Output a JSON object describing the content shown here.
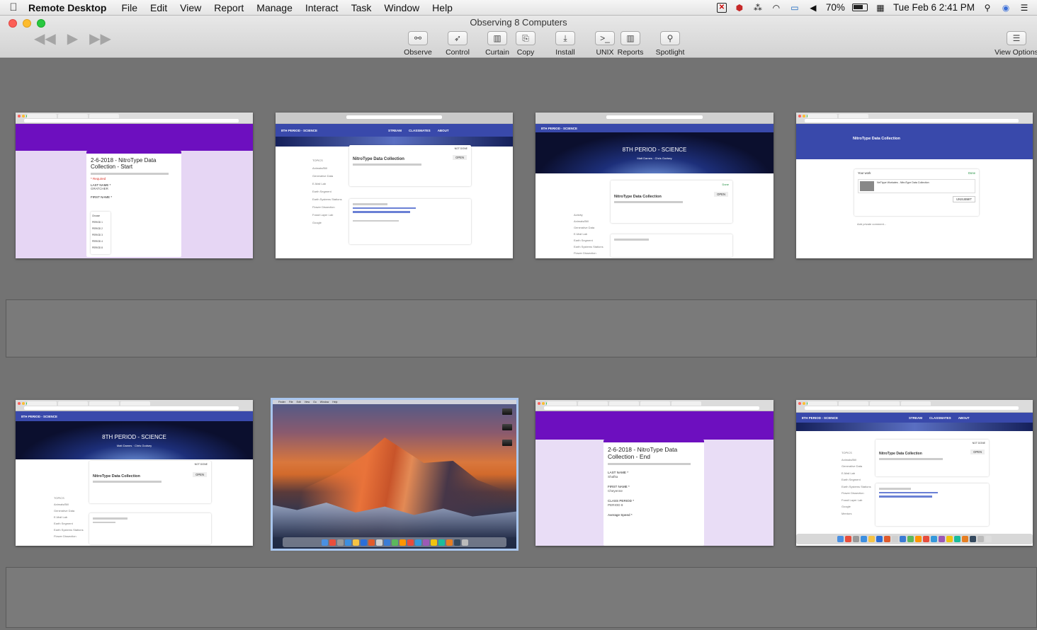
{
  "menubar": {
    "app_name": "Remote Desktop",
    "menus": [
      "File",
      "Edit",
      "View",
      "Report",
      "Manage",
      "Interact",
      "Task",
      "Window",
      "Help"
    ],
    "battery": "70%",
    "datetime": "Tue Feb 6  2:41 PM"
  },
  "window": {
    "title": "Observing 8 Computers"
  },
  "toolbar": {
    "buttons": [
      {
        "label": "Observe",
        "icon": "binoculars-icon"
      },
      {
        "label": "Control",
        "icon": "cursor-icon"
      },
      {
        "label": "Curtain",
        "icon": "curtain-icon"
      },
      {
        "label": "Copy",
        "icon": "copy-icon"
      },
      {
        "label": "Install",
        "icon": "install-icon"
      },
      {
        "label": "UNIX",
        "icon": "terminal-icon"
      },
      {
        "label": "Reports",
        "icon": "reports-icon"
      },
      {
        "label": "Spotlight",
        "icon": "magnifier-icon"
      }
    ],
    "view_options_label": "View Options"
  },
  "screens": {
    "s1": {
      "title": "2-6-2018 - NitroType Data Collection - Start",
      "field1": "LAST NAME *",
      "field1_value": "GRATCHER",
      "field2": "FIRST NAME *",
      "dropdown_options": [
        "Choose",
        "PERIOD 1",
        "PERIOD 2",
        "PERIOD 3",
        "PERIOD 4",
        "PERIOD 8"
      ]
    },
    "s2": {
      "course": "8TH PERIOD - SCIENCE",
      "tabs": [
        "STREAM",
        "CLASSMATES",
        "ABOUT"
      ],
      "assignment": "NitroType Data Collection",
      "status": "NOT DONE",
      "open": "OPEN",
      "topics": [
        "TOPICS",
        "Animals/Bill",
        "Generative Data",
        "E-Mail Lab",
        "Earth Segment",
        "Earth Systems Stations",
        "Flower Dissection",
        "Fossil Layer Lab",
        "Google"
      ]
    },
    "s3": {
      "course": "8TH PERIOD - SCIENCE",
      "banner": "8TH PERIOD - SCIENCE",
      "teachers": [
        "Matt Dames",
        "Chris Godsey"
      ],
      "assignment": "NitroType Data Collection",
      "status": "Done",
      "open": "OPEN",
      "topics": [
        "Activity",
        "Animals/Bill",
        "Generative Data",
        "E-Mail Lab",
        "Earth Segment",
        "Earth Systems Stations",
        "Flower Dissection"
      ]
    },
    "s4": {
      "assignment": "NitroType Data Collection",
      "your_work": "Your work",
      "status": "Done",
      "attachment": "NeTtype Workates - NitroType Data Collection",
      "unsubmit": "UNSUBMIT",
      "comment": "Add private comment..."
    },
    "s5": {
      "course": "8TH PERIOD - SCIENCE",
      "banner": "8TH PERIOD - SCIENCE",
      "teachers": [
        "Matt Dames",
        "Chris Godsey"
      ],
      "assignment": "NitroType Data Collection",
      "status": "NOT DONE",
      "open": "OPEN",
      "topics": [
        "TOPICS",
        "Animals/Bill",
        "Generative Data",
        "E-Mail Lab",
        "Earth Segment",
        "Earth Systems Stations",
        "Flower Dissection"
      ]
    },
    "s6": {
      "menus": [
        "Finder",
        "File",
        "Edit",
        "View",
        "Go",
        "Window",
        "Help"
      ]
    },
    "s7": {
      "title": "2-6-2018 - NitroType Data Collection - End",
      "f1": "LAST NAME *",
      "f1v": "Shafka",
      "f2": "FIRST NAME *",
      "f2v": "Cheyenne",
      "f3": "CLASS PERIOD *",
      "f3v": "PERIOD 8",
      "f4": "Average Speed *"
    },
    "s8": {
      "course": "8TH PERIOD - SCIENCE",
      "tabs": [
        "STREAM",
        "CLASSMATES",
        "ABOUT"
      ],
      "assignment": "NitroType Data Collection",
      "status": "NOT DONE",
      "open": "OPEN",
      "topics": [
        "TOPICS",
        "Animals/Bill",
        "Generative Data",
        "E-Mail Lab",
        "Earth Segment",
        "Earth Systems Stations",
        "Flower Dissection",
        "Fossil Layer Lab",
        "Google",
        "Mentors"
      ]
    }
  },
  "colors": {
    "classroom_blue": "#3949ab",
    "forms_purple": "#6d0fbf",
    "selection": "#a9c6ee"
  }
}
